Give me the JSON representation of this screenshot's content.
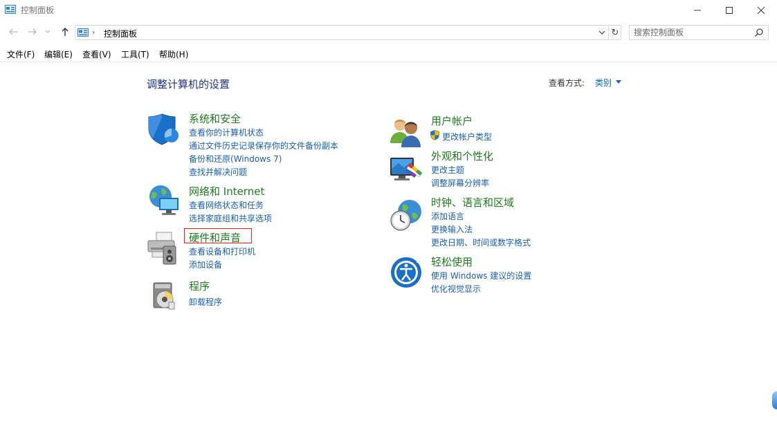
{
  "window": {
    "title": "控制面板"
  },
  "address_bar": {
    "path": "控制面板",
    "separator": "›"
  },
  "search": {
    "placeholder": "搜索控制面板"
  },
  "menu": {
    "items": [
      "文件(F)",
      "编辑(E)",
      "查看(V)",
      "工具(T)",
      "帮助(H)"
    ]
  },
  "content": {
    "title": "调整计算机的设置",
    "view_by_label": "查看方式:",
    "view_by_value": "类别"
  },
  "categories": [
    {
      "title": "系统和安全",
      "icon": "shield-icon",
      "links": [
        "查看你的计算机状态",
        "通过文件历史记录保存你的文件备份副本",
        "备份和还原(Windows 7)",
        "查找并解决问题"
      ]
    },
    {
      "title": "网络和 Internet",
      "icon": "network-globe-icon",
      "links": [
        "查看网络状态和任务",
        "选择家庭组和共享选项"
      ]
    },
    {
      "title": "硬件和声音",
      "icon": "printer-speaker-icon",
      "links": [
        "查看设备和打印机",
        "添加设备"
      ],
      "highlighted": true
    },
    {
      "title": "程序",
      "icon": "programs-disc-icon",
      "links": [
        "卸载程序"
      ]
    },
    {
      "title": "用户帐户",
      "icon": "users-icon",
      "links": [
        "更改帐户类型"
      ],
      "link_icon": "uac-shield-icon"
    },
    {
      "title": "外观和个性化",
      "icon": "monitor-palette-icon",
      "links": [
        "更改主题",
        "调整屏幕分辨率"
      ]
    },
    {
      "title": "时钟、语言和区域",
      "icon": "clock-globe-icon",
      "links": [
        "添加语言",
        "更换输入法",
        "更改日期、时间或数字格式"
      ]
    },
    {
      "title": "轻松使用",
      "icon": "ease-of-access-icon",
      "links": [
        "使用 Windows 建议的设置",
        "优化视觉显示"
      ]
    }
  ],
  "colors": {
    "category_title": "#1f7a1f",
    "link": "#1a5fb4",
    "page_title": "#1e3287",
    "highlight": "#e0201c"
  }
}
